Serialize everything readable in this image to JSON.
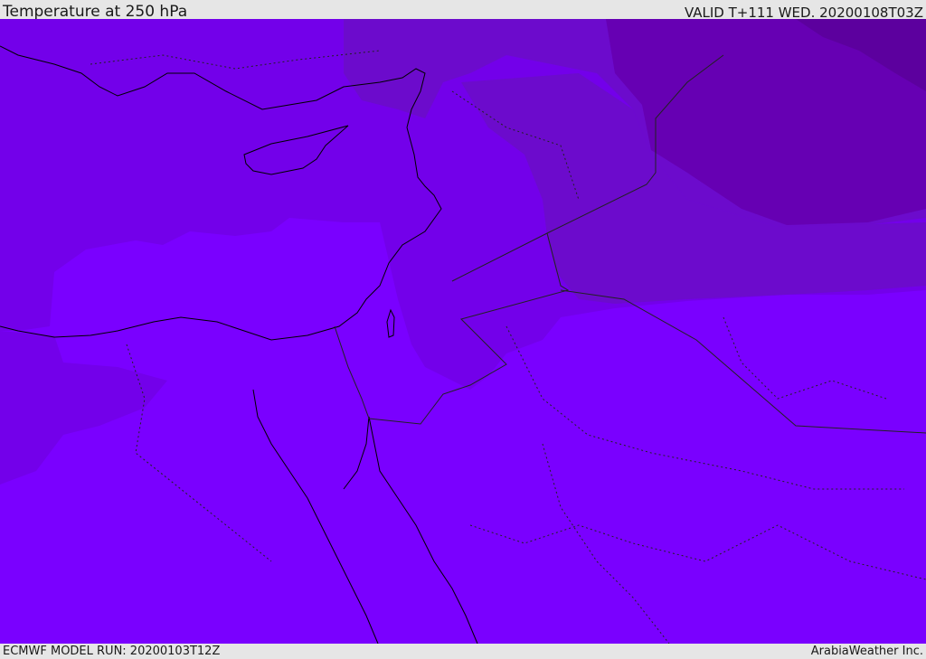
{
  "header": {
    "title": "Temperature at 250 hPa",
    "valid_label": "VALID T+111 WED. 20200108T03Z"
  },
  "footer": {
    "model_run": "ECMWF MODEL RUN: 20200103T12Z",
    "credit": "ArabiaWeather Inc."
  },
  "colors": {
    "band_warmest": "#7a00ff",
    "band_warm": "#7300ea",
    "band_mid": "#6c0bcc",
    "band_cool": "#6600b3",
    "band_coldest": "#5c009e",
    "coast": "#000000",
    "border": "#222222",
    "chrome_bg": "#e6e6e6"
  }
}
